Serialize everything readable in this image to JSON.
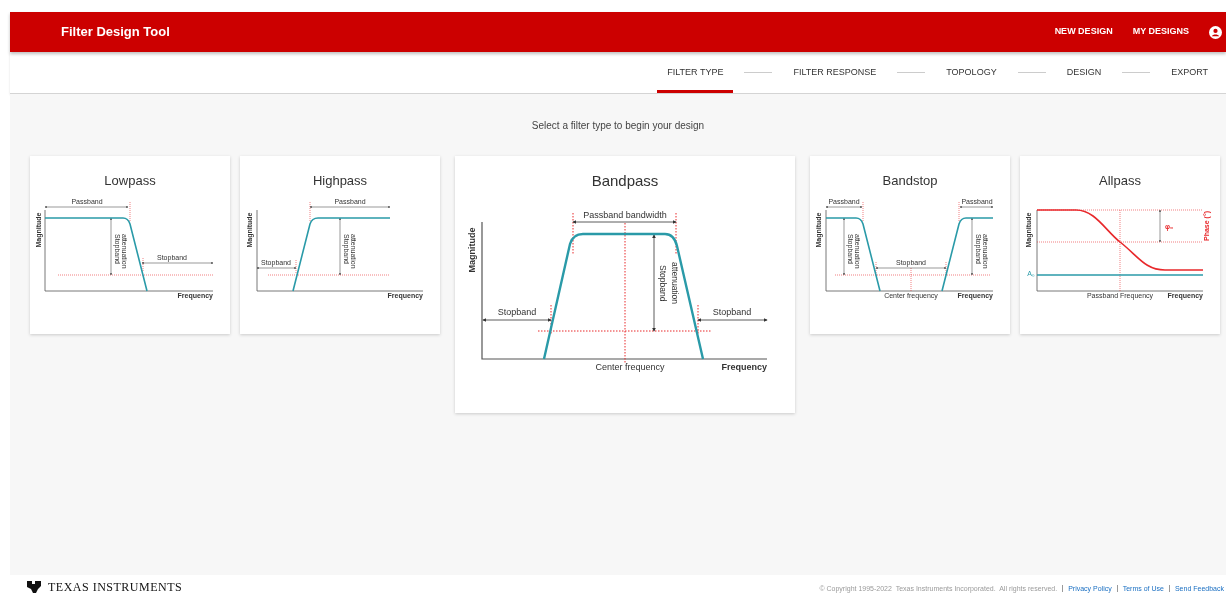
{
  "header": {
    "title": "Filter Design Tool",
    "nav": [
      "NEW DESIGN",
      "MY DESIGNS"
    ]
  },
  "steps": [
    {
      "label": "FILTER TYPE",
      "selected": true
    },
    {
      "label": "FILTER RESPONSE",
      "selected": false
    },
    {
      "label": "TOPOLOGY",
      "selected": false
    },
    {
      "label": "DESIGN",
      "selected": false
    },
    {
      "label": "EXPORT",
      "selected": false
    }
  ],
  "prompt": "Select a filter type to begin your design",
  "cards": [
    {
      "title": "Lowpass",
      "kind": "lowpass",
      "labels": [
        "Magnitude",
        "Passband",
        "Stopband",
        "attenuation",
        "Stopband",
        "Frequency"
      ]
    },
    {
      "title": "Highpass",
      "kind": "highpass",
      "labels": [
        "Magnitude",
        "Passband",
        "Stopband",
        "attenuation",
        "Stopband",
        "Frequency"
      ]
    },
    {
      "title": "Bandpass",
      "kind": "bandpass",
      "labels": [
        "Magnitude",
        "Passband bandwidth",
        "Stopband",
        "attenuation",
        "Stopband",
        "Stopband",
        "Center frequency",
        "Frequency"
      ]
    },
    {
      "title": "Bandstop",
      "kind": "bandstop",
      "labels": [
        "Magnitude",
        "Passband",
        "Passband",
        "Stopband",
        "attenuation",
        "Stopband",
        "attenuation",
        "Stopband",
        "Center frequency",
        "Frequency"
      ]
    },
    {
      "title": "Allpass",
      "kind": "allpass",
      "labels": [
        "Magnitude",
        "φ₀",
        "Phase (°)",
        "A₀",
        "Passband Frequency",
        "Frequency"
      ]
    }
  ],
  "footer": {
    "brand": "TEXAS INSTRUMENTS",
    "copyright": "© Copyright 1995-2022  Texas Instruments Incorporated.  All rights reserved.",
    "links": [
      "Privacy Policy",
      "Terms of Use",
      "Send Feedback"
    ]
  }
}
